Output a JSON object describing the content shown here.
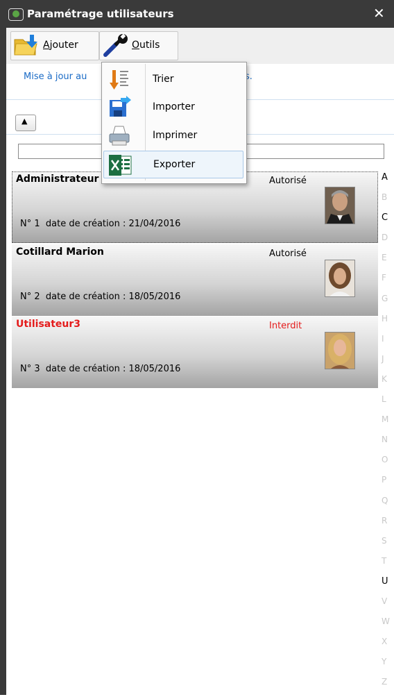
{
  "window": {
    "title": "Paramétrage utilisateurs",
    "close_symbol": "✕"
  },
  "toolbar": {
    "add_label": "Ajouter",
    "add_accel": "A",
    "tools_label": "Outils",
    "tools_accel": "O"
  },
  "info": {
    "text_start": "Mise à jour au",
    "text_end": "s."
  },
  "sort": {
    "symbol": "▲"
  },
  "search": {
    "value": "",
    "placeholder": ""
  },
  "menu": {
    "items": [
      {
        "label": "Trier",
        "icon": "sort-icon"
      },
      {
        "label": "Importer",
        "icon": "import-icon"
      },
      {
        "label": "Imprimer",
        "icon": "printer-icon"
      },
      {
        "label": "Exporter",
        "icon": "excel-icon"
      }
    ]
  },
  "users": [
    {
      "name": "Administrateur",
      "status": "Autorisé",
      "number": "N° 1",
      "created": "date de création : 21/04/2016"
    },
    {
      "name": "Cotillard Marion",
      "status": "Autorisé",
      "number": "N° 2",
      "created": "date de création : 18/05/2016"
    },
    {
      "name": "Utilisateur3",
      "status": "Interdit",
      "number": "N° 3",
      "created": "date de création : 18/05/2016"
    }
  ],
  "alphabet": [
    "A",
    "B",
    "C",
    "D",
    "E",
    "F",
    "G",
    "H",
    "I",
    "J",
    "K",
    "L",
    "M",
    "N",
    "O",
    "P",
    "Q",
    "R",
    "S",
    "T",
    "U",
    "V",
    "W",
    "X",
    "Y",
    "Z"
  ],
  "alphabet_active": [
    "A",
    "C",
    "U"
  ],
  "colors": {
    "link": "#1a6bc6",
    "forbidden": "#e41b1b",
    "titlebar": "#3a3a3a"
  }
}
